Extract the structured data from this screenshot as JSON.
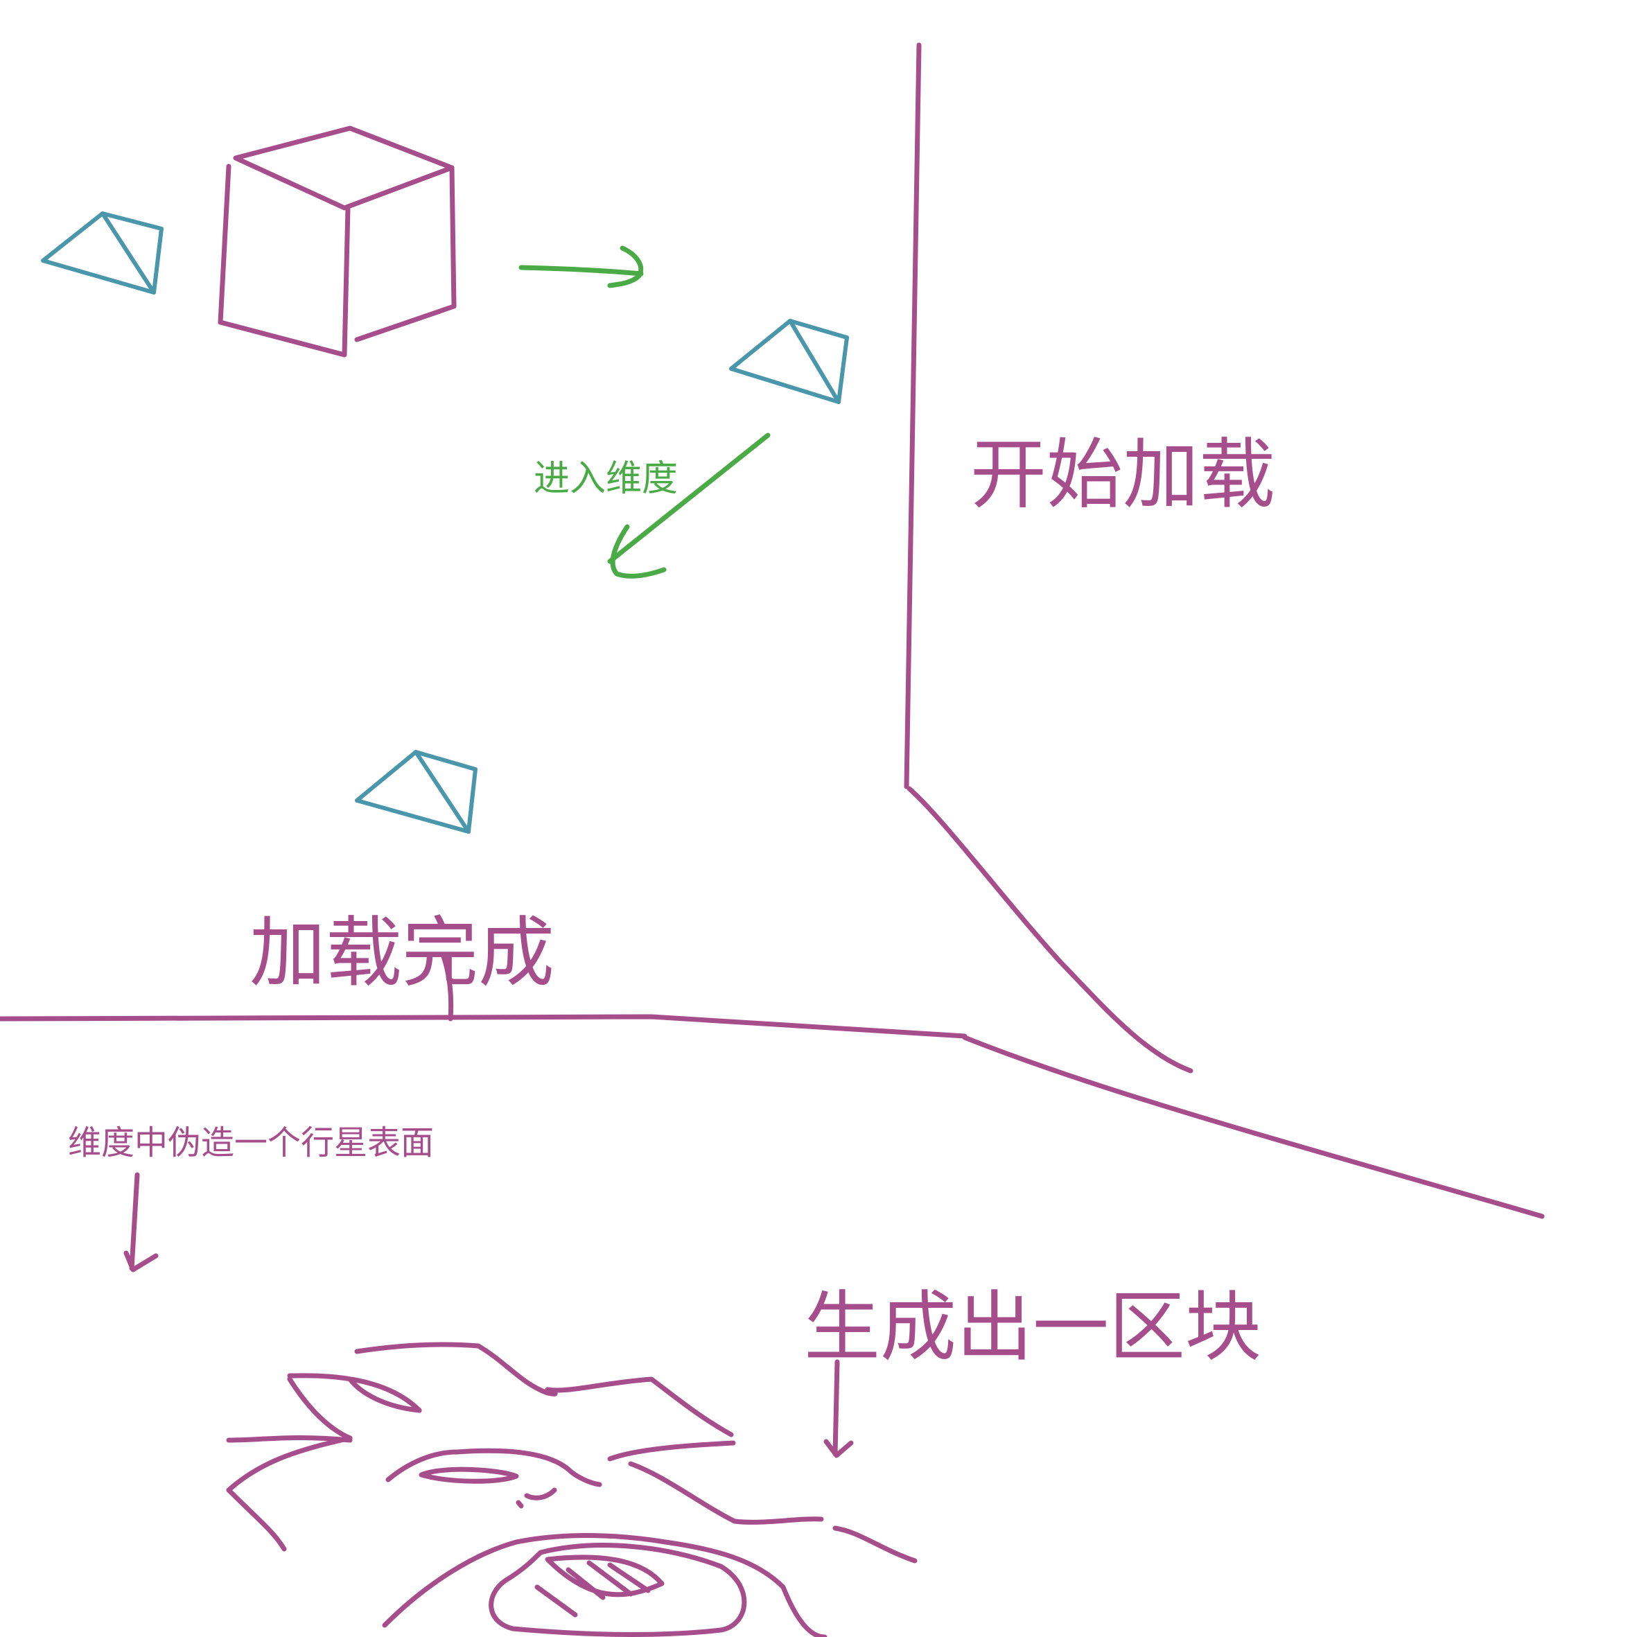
{
  "labels": {
    "start_loading": "开始加载",
    "loading_done": "加载完成",
    "enter_dimension": "进入维度",
    "fake_planet_surface": "维度中伪造一个行星表面",
    "generate_block": "生成出一区块"
  },
  "colors": {
    "purple": "#a64d8c",
    "teal": "#4a96aa",
    "green": "#4aaa46"
  }
}
